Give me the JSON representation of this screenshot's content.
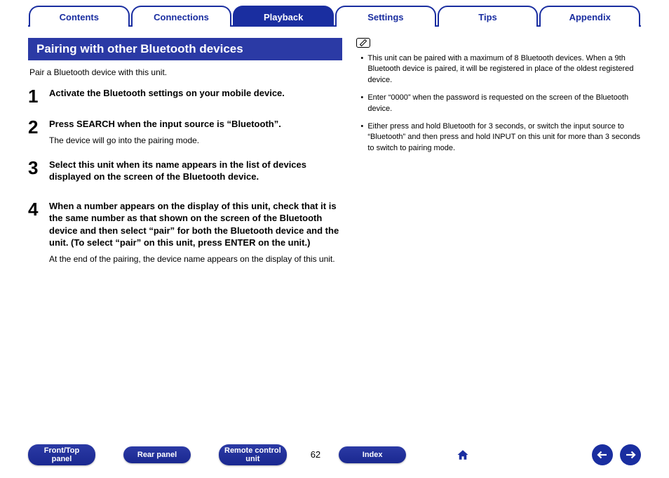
{
  "tabs": {
    "contents": "Contents",
    "connections": "Connections",
    "playback": "Playback",
    "settings": "Settings",
    "tips": "Tips",
    "appendix": "Appendix",
    "active": "playback"
  },
  "section_title": "Pairing with other Bluetooth devices",
  "intro": "Pair a Bluetooth device with this unit.",
  "steps": [
    {
      "num": "1",
      "title": "Activate the Bluetooth settings on your mobile device.",
      "desc": ""
    },
    {
      "num": "2",
      "title": "Press SEARCH when the input source is “Bluetooth”.",
      "desc": "The device will go into the pairing mode."
    },
    {
      "num": "3",
      "title": "Select this unit when its name appears in the list of devices displayed on the screen of the Bluetooth device.",
      "desc": ""
    },
    {
      "num": "4",
      "title": "When a number appears on the display of this unit, check that it is the same number as that shown on the screen of the Bluetooth device and then select “pair” for both the Bluetooth device and the unit. (To select “pair” on this unit, press ENTER on the unit.)",
      "desc": "At the end of the pairing, the device name appears on the display of this unit."
    }
  ],
  "notes": [
    "This unit can be paired with a maximum of 8 Bluetooth devices. When a 9th Bluetooth device is paired, it will be registered in place of the oldest registered device.",
    "Enter “0000” when the password is requested on the screen of the Bluetooth device.",
    "Either press and hold Bluetooth for 3 seconds, or switch the input source to “Bluetooth” and then press and hold INPUT on this unit for more than 3 seconds to switch to pairing mode."
  ],
  "bottom": {
    "front_top": "Front/Top\npanel",
    "rear": "Rear panel",
    "remote": "Remote control\nunit",
    "index": "Index",
    "page": "62"
  }
}
